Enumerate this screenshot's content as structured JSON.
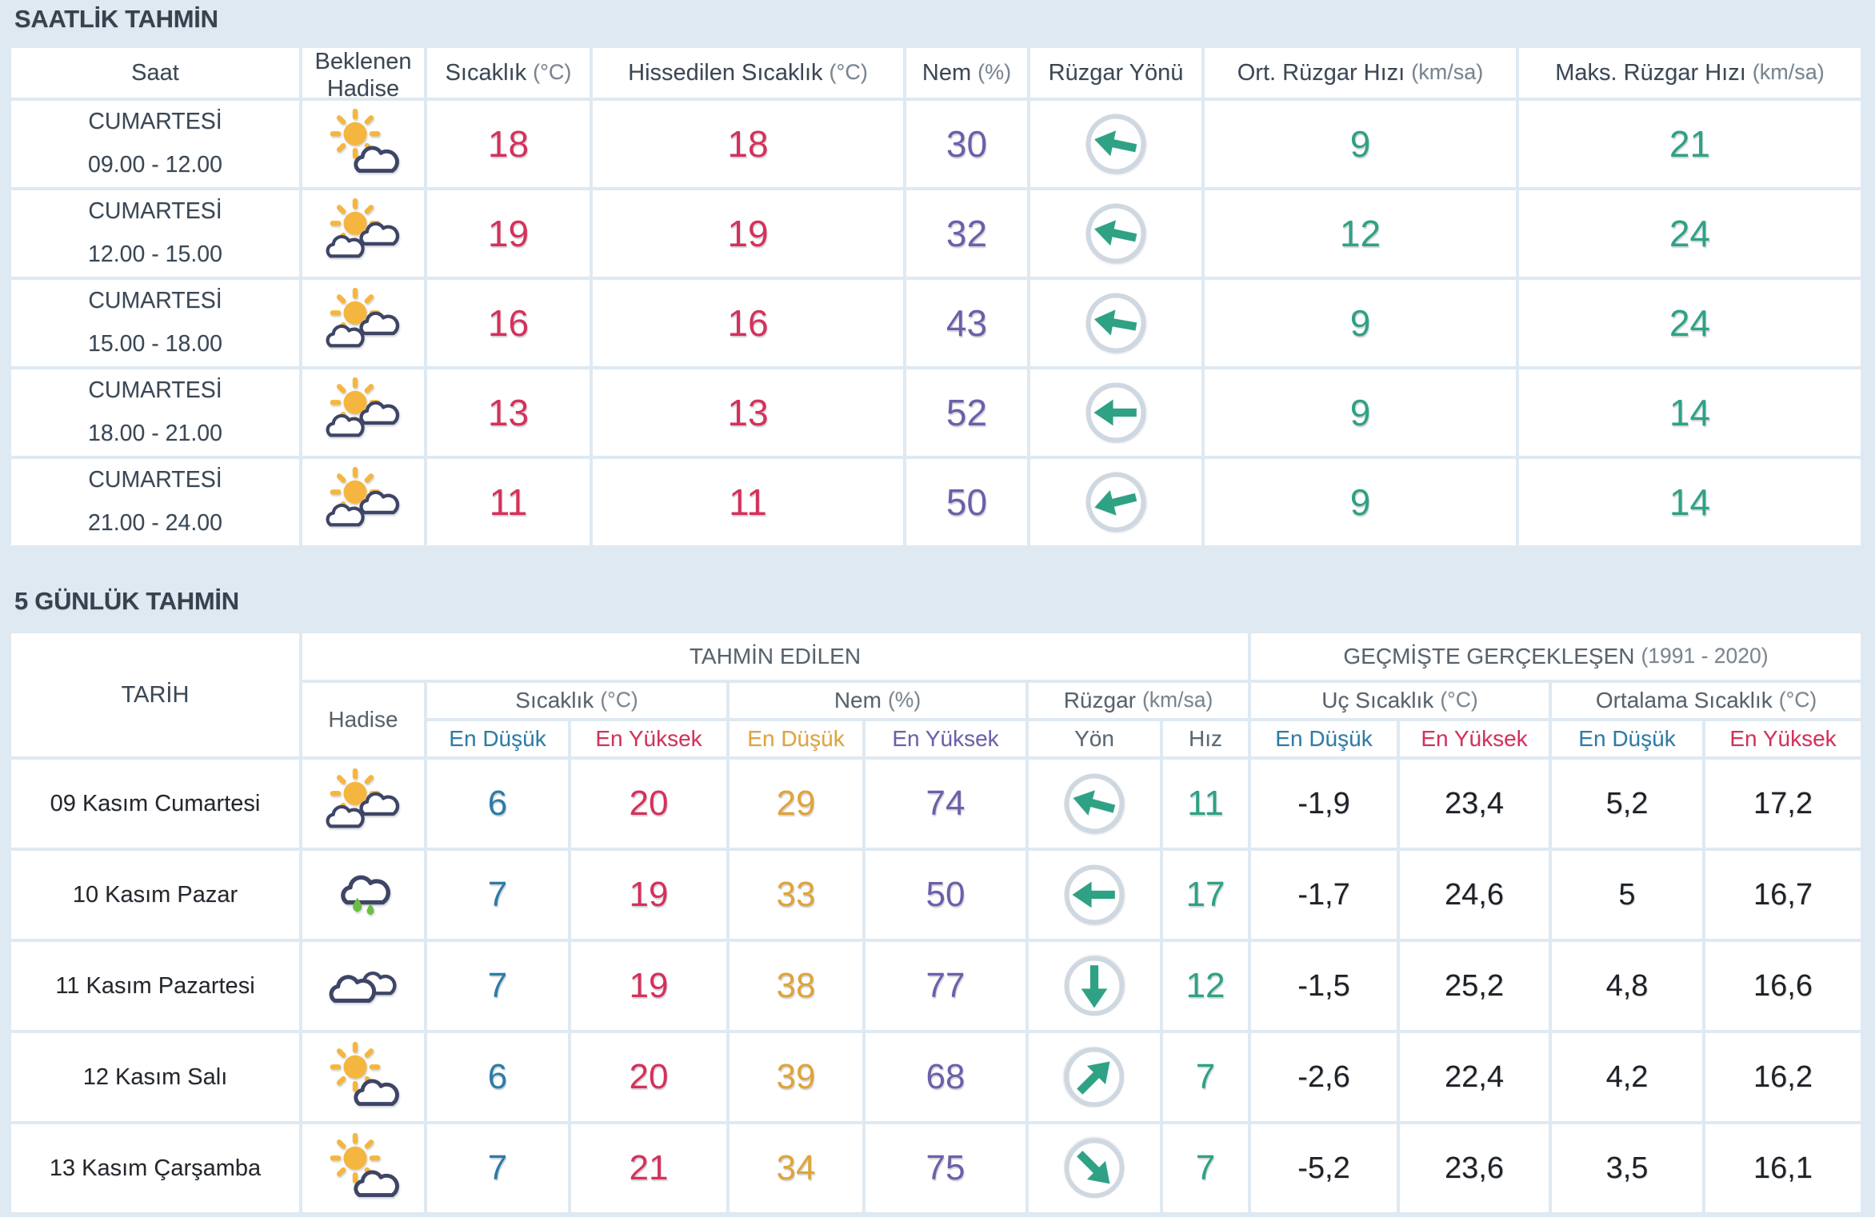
{
  "colors": {
    "page_bg": "#dfe9f1",
    "cell_bg": "#ffffff",
    "header_dark": "#3b4754",
    "header_gray": "#58626b",
    "low_blue": "#2d7ca6",
    "high_red": "#d4315b",
    "humidity_low_orange": "#dfa43a",
    "humidity_high_purple": "#6b60a9",
    "wind_green": "#2fa184",
    "sun_yellow": "#f5b63f",
    "cloud_outline": "#3e4565",
    "rain_drop_green": "#6abd47"
  },
  "hourly_section": {
    "title": "SAATLİK TAHMİN",
    "header": {
      "saat": "Saat",
      "beklenen_hadise": "Beklenen Hadise",
      "sicaklik": "Sıcaklık",
      "sicaklik_unit": "(°C)",
      "hissedilen": "Hissedilen Sıcaklık",
      "hissedilen_unit": "(°C)",
      "nem": "Nem",
      "nem_unit": "(%)",
      "ruzgar_yonu": "Rüzgar Yönü",
      "ort_ruzgar": "Ort. Rüzgar Hızı",
      "ort_ruzgar_unit": "(km/sa)",
      "maks_ruzgar": "Maks. Rüzgar Hızı",
      "maks_ruzgar_unit": "(km/sa)"
    },
    "rows": [
      {
        "day": "CUMARTESİ",
        "hours": "09.00 - 12.00",
        "icon": "sun-cloud",
        "temp": "18",
        "feels_like": "18",
        "humidity": "30",
        "wind_dir_rotation_deg": 12,
        "wind_avg": "9",
        "wind_max": "21"
      },
      {
        "day": "CUMARTESİ",
        "hours": "12.00 - 15.00",
        "icon": "sun-two-clouds",
        "temp": "19",
        "feels_like": "19",
        "humidity": "32",
        "wind_dir_rotation_deg": 12,
        "wind_avg": "12",
        "wind_max": "24"
      },
      {
        "day": "CUMARTESİ",
        "hours": "15.00 - 18.00",
        "icon": "sun-two-clouds",
        "temp": "16",
        "feels_like": "16",
        "humidity": "43",
        "wind_dir_rotation_deg": 10,
        "wind_avg": "9",
        "wind_max": "24"
      },
      {
        "day": "CUMARTESİ",
        "hours": "18.00 - 21.00",
        "icon": "sun-two-clouds",
        "temp": "13",
        "feels_like": "13",
        "humidity": "52",
        "wind_dir_rotation_deg": 0,
        "wind_avg": "9",
        "wind_max": "14"
      },
      {
        "day": "CUMARTESİ",
        "hours": "21.00 - 24.00",
        "icon": "sun-two-clouds",
        "temp": "11",
        "feels_like": "11",
        "humidity": "50",
        "wind_dir_rotation_deg": -14,
        "wind_avg": "9",
        "wind_max": "14"
      }
    ]
  },
  "daily_section": {
    "title": "5 GÜNLÜK TAHMİN",
    "header": {
      "tarih": "TARİH",
      "tahmin_edilen": "TAHMİN EDİLEN",
      "gecmiste": "GEÇMİŞTE GERÇEKLEŞEN",
      "gecmiste_period": "(1991 - 2020)",
      "hadise": "Hadise",
      "sicaklik": "Sıcaklık",
      "sicaklik_unit": "(°C)",
      "nem": "Nem",
      "nem_unit": "(%)",
      "ruzgar": "Rüzgar",
      "ruzgar_unit": "(km/sa)",
      "uc_sicaklik": "Uç Sıcaklık",
      "uc_sicaklik_unit": "(°C)",
      "ortalama_sicaklik": "Ortalama Sıcaklık",
      "ortalama_sicaklik_unit": "(°C)",
      "en_dusuk": "En Düşük",
      "en_yuksek": "En Yüksek",
      "yon": "Yön",
      "hiz": "Hız"
    },
    "rows": [
      {
        "date": "09 Kasım Cumartesi",
        "icon": "sun-two-clouds",
        "temp_min": "6",
        "temp_max": "20",
        "hum_min": "29",
        "hum_max": "74",
        "wind_dir_rotation_deg": 15,
        "wind_speed": "11",
        "hist_min": "-1,9",
        "hist_max": "23,4",
        "avg_min": "5,2",
        "avg_max": "17,2"
      },
      {
        "date": "10 Kasım Pazar",
        "icon": "rain",
        "temp_min": "7",
        "temp_max": "19",
        "hum_min": "33",
        "hum_max": "50",
        "wind_dir_rotation_deg": 0,
        "wind_speed": "17",
        "hist_min": "-1,7",
        "hist_max": "24,6",
        "avg_min": "5",
        "avg_max": "16,7"
      },
      {
        "date": "11 Kasım Pazartesi",
        "icon": "clouds",
        "temp_min": "7",
        "temp_max": "19",
        "hum_min": "38",
        "hum_max": "77",
        "wind_dir_rotation_deg": -90,
        "wind_speed": "12",
        "hist_min": "-1,5",
        "hist_max": "25,2",
        "avg_min": "4,8",
        "avg_max": "16,6"
      },
      {
        "date": "12 Kasım Salı",
        "icon": "sun-cloud",
        "temp_min": "6",
        "temp_max": "20",
        "hum_min": "39",
        "hum_max": "68",
        "wind_dir_rotation_deg": 135,
        "wind_speed": "7",
        "hist_min": "-2,6",
        "hist_max": "22,4",
        "avg_min": "4,2",
        "avg_max": "16,2"
      },
      {
        "date": "13 Kasım Çarşamba",
        "icon": "sun-cloud",
        "temp_min": "7",
        "temp_max": "21",
        "hum_min": "34",
        "hum_max": "75",
        "wind_dir_rotation_deg": -135,
        "wind_speed": "7",
        "hist_min": "-5,2",
        "hist_max": "23,6",
        "avg_min": "3,5",
        "avg_max": "16,1"
      }
    ]
  }
}
